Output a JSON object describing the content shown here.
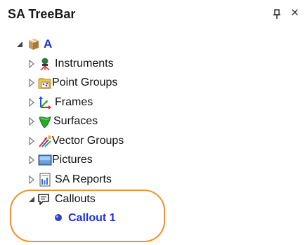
{
  "panel": {
    "title": "SA TreeBar",
    "pin_icon": "pin-icon",
    "close_label": "×"
  },
  "tree": {
    "root": {
      "label": "A",
      "icon": "package-icon"
    },
    "items": [
      {
        "label": "Instruments",
        "icon": "instrument-icon"
      },
      {
        "label": "Point Groups",
        "icon": "point-groups-icon"
      },
      {
        "label": "Frames",
        "icon": "frame-axes-icon"
      },
      {
        "label": "Surfaces",
        "icon": "surface-icon"
      },
      {
        "label": "Vector Groups",
        "icon": "vector-groups-icon"
      },
      {
        "label": "Pictures",
        "icon": "picture-icon"
      },
      {
        "label": "SA Reports",
        "icon": "report-icon"
      },
      {
        "label": "Callouts",
        "icon": "callout-icon"
      }
    ],
    "callout_child": {
      "label": "Callout 1",
      "icon": "bullet-icon"
    }
  },
  "colors": {
    "highlight_ring": "#f0922e",
    "selected_text": "#1a32d6"
  }
}
